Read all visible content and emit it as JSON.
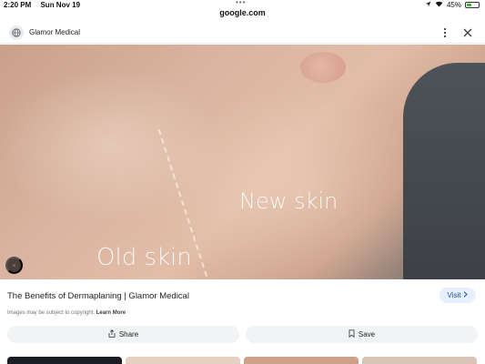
{
  "status": {
    "time": "2:20 PM",
    "date": "Sun Nov 19",
    "battery": "45%",
    "battery_level": 0.45,
    "icons": [
      "location-icon",
      "wifi-icon",
      "battery-icon"
    ]
  },
  "browser": {
    "domain": "google.com"
  },
  "site": {
    "name": "Glamor Medical",
    "icon": "globe-icon"
  },
  "image": {
    "overlay_new": "New skin",
    "overlay_old": "Old skin"
  },
  "result": {
    "title": "The Benefits of Dermaplaning | Glamor Medical",
    "visit_label": "Visit",
    "copyright_text": "Images may be subject to copyright.",
    "learn_more": "Learn More",
    "share_label": "Share",
    "save_label": "Save"
  },
  "colors": {
    "visit_bg": "#e8f0fe",
    "visit_text": "#1a4fb6",
    "button_bg": "#f1f3f4"
  }
}
